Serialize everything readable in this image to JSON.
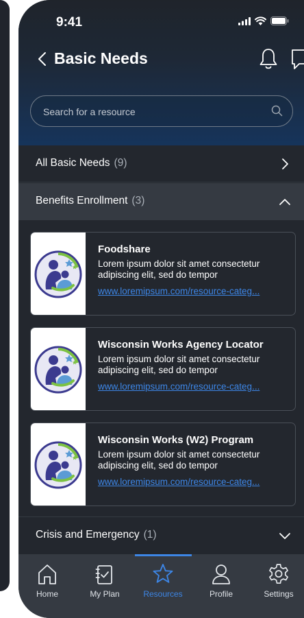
{
  "status_bar": {
    "time": "9:41"
  },
  "header": {
    "title": "Basic Needs"
  },
  "search": {
    "placeholder": "Search for a resource"
  },
  "categories": [
    {
      "label": "All Basic Needs",
      "count": "(9)"
    },
    {
      "label": "Benefits Enrollment",
      "count": "(3)"
    },
    {
      "label": "Crisis and Emergency",
      "count": "(1)"
    }
  ],
  "resources": [
    {
      "title": "Foodshare",
      "description": "Lorem ipsum dolor sit amet consectetur adipiscing elit, sed do tempor",
      "link": "www.loremipsum.com/resource-categ..."
    },
    {
      "title": "Wisconsin Works Agency Locator",
      "description": "Lorem ipsum dolor sit amet consectetur adipiscing elit, sed do tempor",
      "link": "www.loremipsum.com/resource-categ..."
    },
    {
      "title": "Wisconsin Works (W2) Program",
      "description": "Lorem ipsum dolor sit amet consectetur adipiscing elit, sed do tempor",
      "link": "www.loremipsum.com/resource-categ..."
    }
  ],
  "tabs": [
    {
      "label": "Home",
      "icon": "home-icon"
    },
    {
      "label": "My Plan",
      "icon": "clipboard-icon"
    },
    {
      "label": "Resources",
      "icon": "star-icon",
      "active": true
    },
    {
      "label": "Profile",
      "icon": "person-icon"
    },
    {
      "label": "Settings",
      "icon": "gear-icon"
    }
  ],
  "colors": {
    "accent": "#3d86e6",
    "background": "#23272e",
    "expanded_row": "#353a42",
    "tab_bar": "#353a42"
  }
}
